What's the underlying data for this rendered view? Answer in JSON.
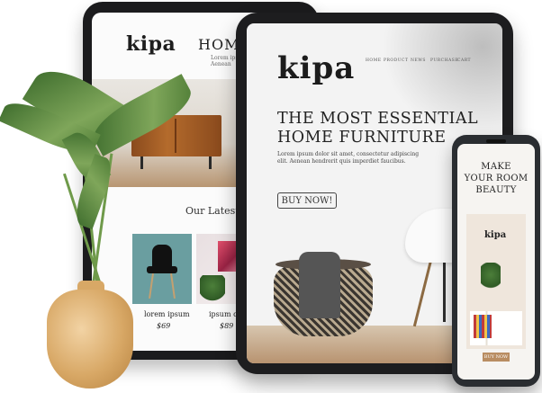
{
  "back_tablet": {
    "logo": "kipa",
    "heading": "HOME",
    "subtext_line1": "Lorem ipsum",
    "subtext_line2": "Aenean",
    "section_title": "Our Latest F",
    "products": [
      {
        "name": "lorem ipsum",
        "price": "$69"
      },
      {
        "name": "ipsum do",
        "price": "$89"
      }
    ]
  },
  "front_tablet": {
    "logo": "kipa",
    "nav": [
      "HOME",
      "PRODUCT",
      "NEWS",
      "PURCHASE",
      "CART"
    ],
    "headline_line1": "THE MOST ESSENTIAL",
    "headline_line2": "HOME FURNITURE",
    "body_line1": "Lorem ipsum dolor sit amet, consectetur adipiscing",
    "body_line2": "elit. Aenean hendrerit quis imperdiet faucibus.",
    "cta": "BUY NOW!"
  },
  "phone": {
    "headline_line1": "MAKE",
    "headline_line2": "YOUR ROOM",
    "headline_line3": "BEAUTY",
    "logo": "kipa",
    "cta": "BUY NOW"
  }
}
